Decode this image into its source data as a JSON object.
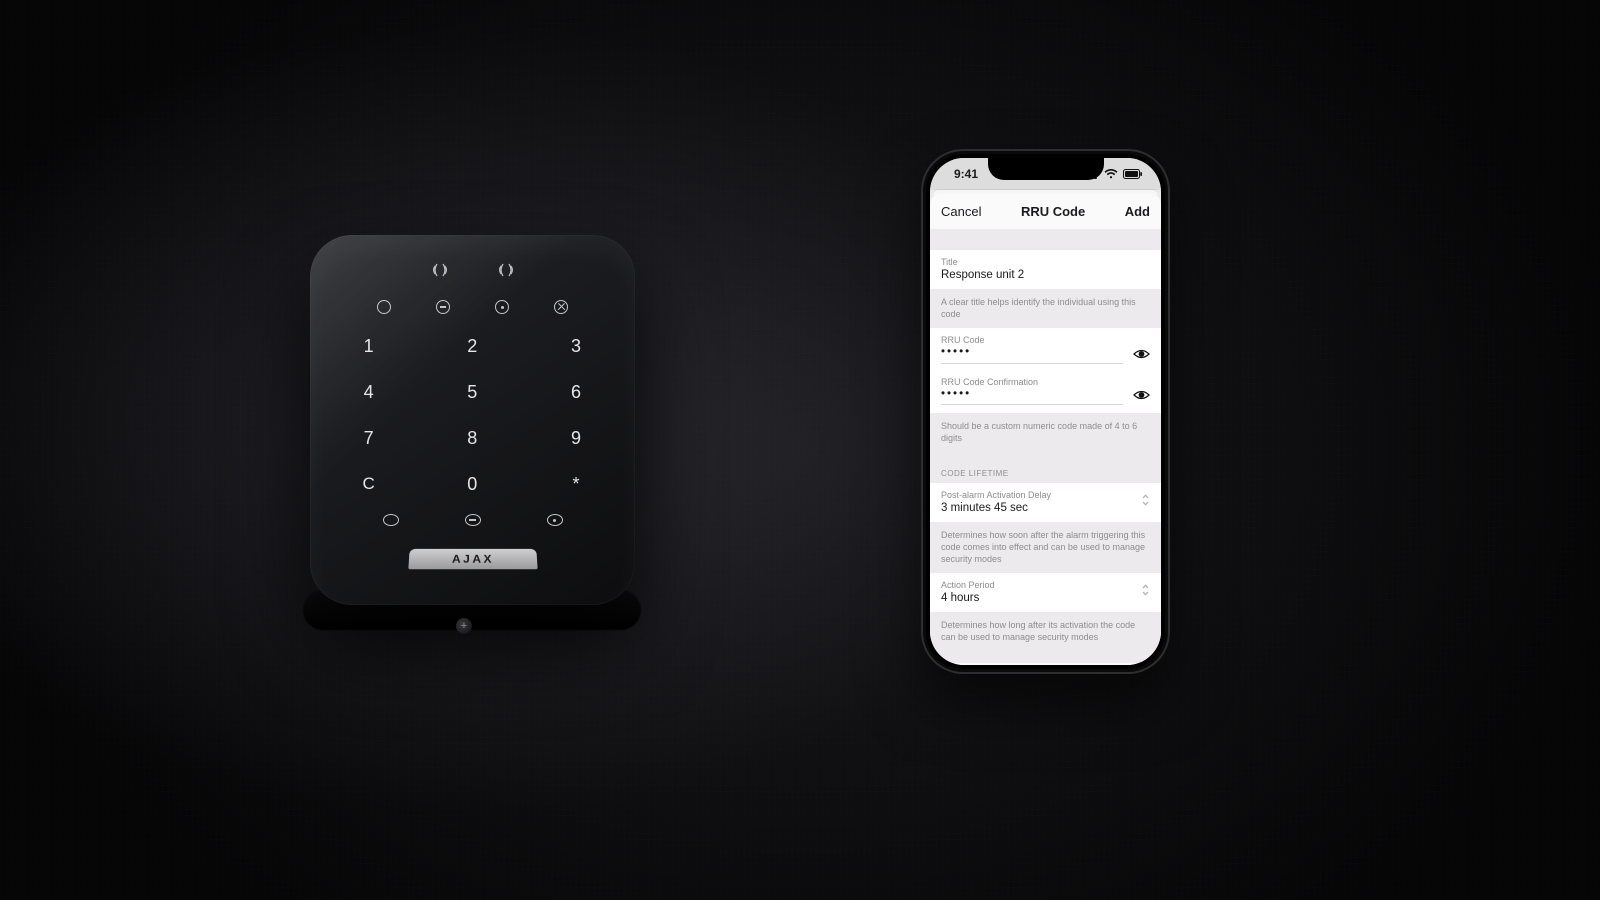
{
  "keypad": {
    "brand": "AJAX",
    "keys": [
      "1",
      "2",
      "3",
      "4",
      "5",
      "6",
      "7",
      "8",
      "9",
      "C",
      "0",
      "*"
    ]
  },
  "phone": {
    "status_time": "9:41",
    "sheet": {
      "cancel": "Cancel",
      "title": "RRU Code",
      "add": "Add"
    },
    "title_field": {
      "label": "Title",
      "value": "Response unit 2",
      "hint": "A clear title helps identify the individual using this code"
    },
    "code_field": {
      "label": "RRU Code",
      "masked": "•••••"
    },
    "code_confirm_field": {
      "label": "RRU Code Confirmation",
      "masked": "•••••",
      "hint": "Should be a custom numeric code made of 4 to 6 digits"
    },
    "lifetime_section": "CODE LIFETIME",
    "activation_delay": {
      "label": "Post-alarm Activation Delay",
      "value": "3 minutes 45 sec",
      "hint": "Determines how soon after the alarm triggering this code comes into effect and can be used to manage security modes"
    },
    "action_period": {
      "label": "Action Period",
      "value": "4 hours",
      "hint": "Determines how long after its activation the code can be used to manage security modes"
    }
  }
}
